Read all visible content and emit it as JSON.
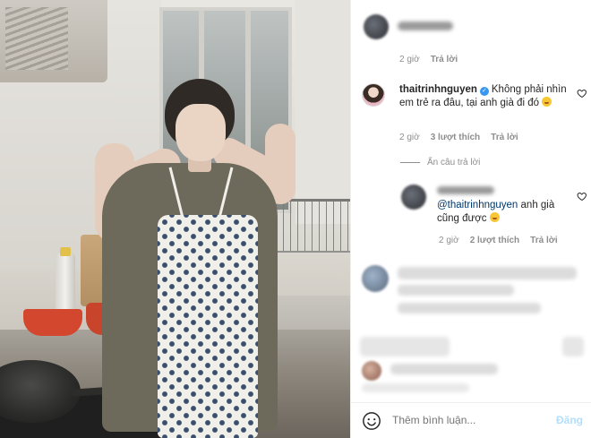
{
  "comments": [
    {
      "meta": {
        "time": "2 giờ",
        "reply": "Trả lời"
      }
    },
    {
      "username": "thaitrinhnguyen",
      "text": "Không phải nhìn em trẻ ra đâu, tại anh già đi đó",
      "meta": {
        "time": "2 giờ",
        "likes": "3 lượt thích",
        "reply": "Trả lời"
      },
      "hide_replies": "Ẩn câu trả lời",
      "replies": [
        {
          "mention": "@thaitrinhnguyen",
          "text": "anh già cũng được",
          "meta": {
            "time": "2 giờ",
            "likes": "2 lượt thích",
            "reply": "Trả lời"
          }
        }
      ]
    }
  ],
  "footer": {
    "placeholder": "Thêm bình luận...",
    "post_label": "Đăng"
  },
  "colors": {
    "verified": "#3897f0",
    "mention": "#00376b",
    "post_disabled": "#b2dffc",
    "meta_gray": "#8e8e8e"
  },
  "icons": [
    "heart-icon",
    "verified-badge-icon",
    "smiley-icon",
    "emoji-icon"
  ]
}
